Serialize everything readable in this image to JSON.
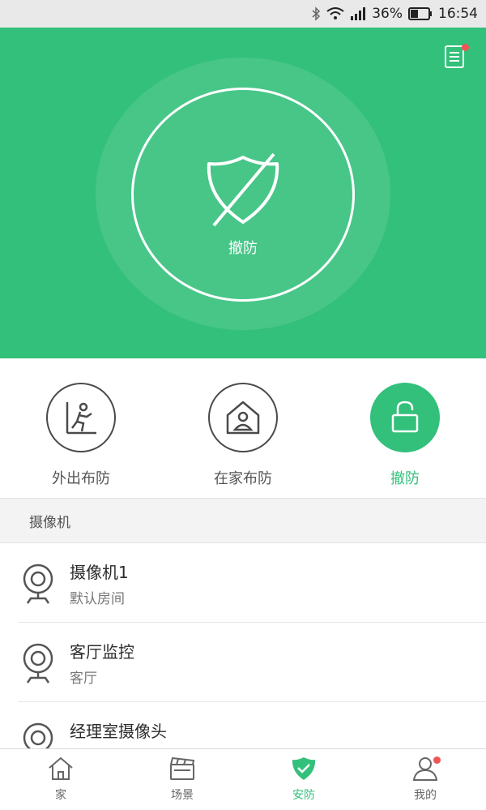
{
  "status_bar": {
    "battery_percent": "36%",
    "time": "16:54"
  },
  "hero": {
    "state_label": "撤防"
  },
  "modes": [
    {
      "label": "外出布防",
      "active": false
    },
    {
      "label": "在家布防",
      "active": false
    },
    {
      "label": "撤防",
      "active": true
    }
  ],
  "section": {
    "title": "摄像机"
  },
  "cameras": [
    {
      "name": "摄像机1",
      "room": "默认房间"
    },
    {
      "name": "客厅监控",
      "room": "客厅"
    },
    {
      "name": "经理室摄像头",
      "room": ""
    }
  ],
  "tabs": [
    {
      "label": "家",
      "icon": "home-icon"
    },
    {
      "label": "场景",
      "icon": "clapper-icon"
    },
    {
      "label": "安防",
      "icon": "shield-check-icon",
      "active": true
    },
    {
      "label": "我的",
      "icon": "user-icon"
    }
  ],
  "colors": {
    "accent": "#33c07b",
    "badge": "#f05454"
  }
}
